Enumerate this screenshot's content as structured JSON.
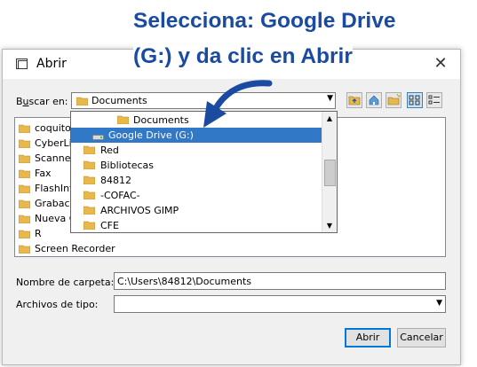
{
  "annotation": {
    "line1": "Selecciona: Google Drive",
    "line2": "(G:) y da clic en Abrir"
  },
  "dialog": {
    "title": "Abrir",
    "close_glyph": "✕"
  },
  "lookin": {
    "label_prefix": "B",
    "label_underlined": "u",
    "label_suffix": "scar en:",
    "value": "Documents"
  },
  "dropdown": {
    "items": [
      {
        "label": "Documents",
        "icon": "folder-icon"
      },
      {
        "label": "Google Drive (G:)",
        "icon": "drive-icon",
        "selected": true
      },
      {
        "label": "Red",
        "icon": "folder-icon"
      },
      {
        "label": "Bibliotecas",
        "icon": "folder-icon"
      },
      {
        "label": "84812",
        "icon": "folder-icon"
      },
      {
        "label": "-COFAC-",
        "icon": "folder-icon"
      },
      {
        "label": "ARCHIVOS GIMP",
        "icon": "folder-icon"
      },
      {
        "label": "CFE",
        "icon": "folder-icon"
      }
    ]
  },
  "files": {
    "items": [
      "coquito",
      "CyberLin",
      "Scanned",
      "Fax",
      "FlashInte",
      "Grabacio",
      "Nueva C",
      "R",
      "Screen Recorder"
    ]
  },
  "folder_name": {
    "label": "Nombre de carpeta:",
    "value": "C:\\Users\\84812\\Documents"
  },
  "file_type": {
    "label": "Archivos de tipo:",
    "value": ""
  },
  "buttons": {
    "open": "Abrir",
    "cancel": "Cancelar"
  },
  "colors": {
    "annotation": "#1b4ba0",
    "selection": "#3178c6",
    "folder": "#e8b94a"
  }
}
